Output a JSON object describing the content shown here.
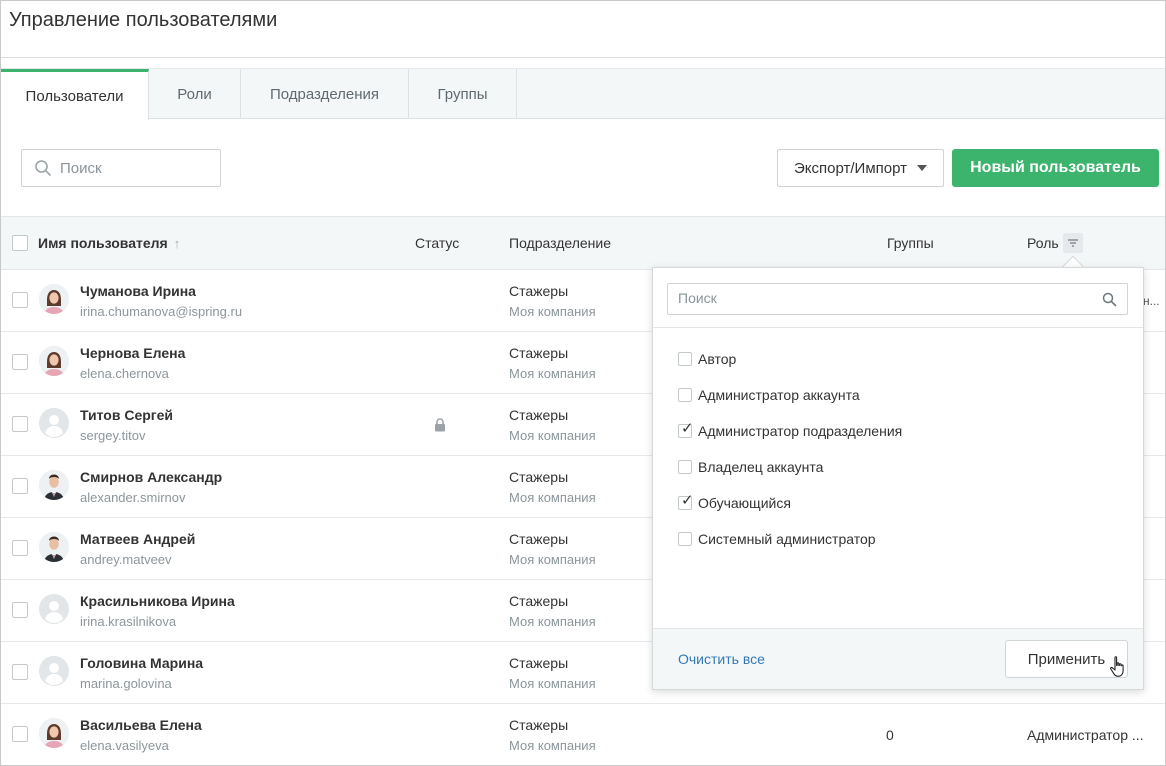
{
  "page": {
    "title": "Управление пользователями"
  },
  "tabs": [
    {
      "label": "Пользователи",
      "active": true
    },
    {
      "label": "Роли",
      "active": false
    },
    {
      "label": "Подразделения",
      "active": false
    },
    {
      "label": "Группы",
      "active": false
    }
  ],
  "toolbar": {
    "search_placeholder": "Поиск",
    "export_label": "Экспорт/Импорт",
    "new_user_label": "Новый пользователь"
  },
  "table": {
    "columns": {
      "name": "Имя пользователя",
      "status": "Статус",
      "department": "Подразделение",
      "groups": "Группы",
      "role": "Роль"
    },
    "rows": [
      {
        "name": "Чуманова Ирина",
        "login": "irina.chumanova@ispring.ru",
        "department": "Стажеры",
        "company": "Моя компания",
        "avatar": "photo-female",
        "locked": false,
        "groups": "",
        "role": ""
      },
      {
        "name": "Чернова Елена",
        "login": "elena.chernova",
        "department": "Стажеры",
        "company": "Моя компания",
        "avatar": "photo-female",
        "locked": false,
        "groups": "",
        "role": ""
      },
      {
        "name": "Титов Сергей",
        "login": "sergey.titov",
        "department": "Стажеры",
        "company": "Моя компания",
        "avatar": "placeholder",
        "locked": true,
        "groups": "",
        "role": ""
      },
      {
        "name": "Смирнов Александр",
        "login": "alexander.smirnov",
        "department": "Стажеры",
        "company": "Моя компания",
        "avatar": "photo-male",
        "locked": false,
        "groups": "",
        "role": ""
      },
      {
        "name": "Матвеев Андрей",
        "login": "andrey.matveev",
        "department": "Стажеры",
        "company": "Моя компания",
        "avatar": "photo-male",
        "locked": false,
        "groups": "",
        "role": ""
      },
      {
        "name": "Красильникова Ирина",
        "login": "irina.krasilnikova",
        "department": "Стажеры",
        "company": "Моя компания",
        "avatar": "placeholder",
        "locked": false,
        "groups": "",
        "role": ""
      },
      {
        "name": "Головина Марина",
        "login": "marina.golovina",
        "department": "Стажеры",
        "company": "Моя компания",
        "avatar": "placeholder",
        "locked": false,
        "groups": "",
        "role": ""
      },
      {
        "name": "Васильева Елена",
        "login": "elena.vasilyeva",
        "department": "Стажеры",
        "company": "Моя компания",
        "avatar": "photo-female",
        "locked": false,
        "groups": "0",
        "role": "Администратор ..."
      }
    ],
    "row1_overflow": "н..."
  },
  "role_filter": {
    "search_placeholder": "Поиск",
    "options": [
      {
        "label": "Автор",
        "checked": false
      },
      {
        "label": "Администратор аккаунта",
        "checked": false
      },
      {
        "label": "Администратор подразделения",
        "checked": true
      },
      {
        "label": "Владелец аккаунта",
        "checked": false
      },
      {
        "label": "Обучающийся",
        "checked": true
      },
      {
        "label": "Системный администратор",
        "checked": false
      }
    ],
    "clear_label": "Очистить все",
    "apply_label": "Применить"
  },
  "colors": {
    "accent": "#3cb46e",
    "link": "#3279b7"
  }
}
